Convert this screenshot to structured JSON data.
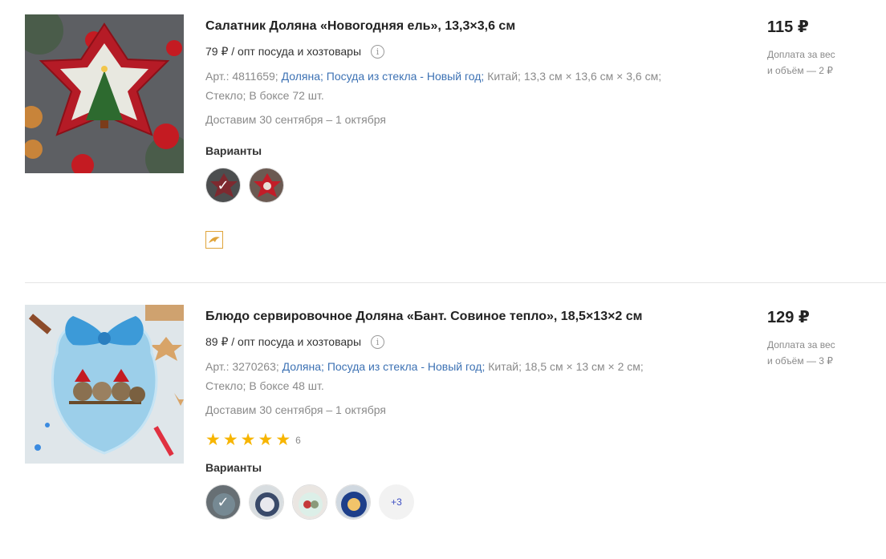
{
  "products": [
    {
      "title": "Салатник Доляна «Новогодняя ель», 13,3×3,6 см",
      "unit_price": "79 ₽ / опт посуда и хозтовары",
      "info_icon": "i",
      "art": "Арт.: 4811659;",
      "brand": "Доляна;",
      "category": "Посуда из стекла - Новый год;",
      "country": "Китай;",
      "dimensions": "13,3 см × 13,6 см × 3,6 см;",
      "material": "Стекло;",
      "box": "В боксе 72 шт.",
      "delivery": "Доставим 30 сентября – 1 октября",
      "variants_label": "Варианты",
      "variants": [
        "selected",
        "star-bowl"
      ],
      "price": "115 ₽",
      "surcharge_line1": "Доплата за вес",
      "surcharge_line2": "и объём — 2 ₽"
    },
    {
      "title": "Блюдо сервировочное Доляна «Бант. Совиное тепло», 18,5×13×2 см",
      "unit_price": "89 ₽ / опт посуда и хозтовары",
      "info_icon": "i",
      "art": "Арт.: 3270263;",
      "brand": "Доляна;",
      "category": "Посуда из стекла - Новый год;",
      "country": "Китай;",
      "dimensions": "18,5 см × 13 см × 2 см;",
      "material": "Стекло;",
      "box": "В боксе 48 шт.",
      "delivery": "Доставим 30 сентября – 1 октября",
      "rating": 5,
      "rating_count": "6",
      "variants_label": "Варианты",
      "variants_more": "+3",
      "price": "129 ₽",
      "surcharge_line1": "Доплата за вес",
      "surcharge_line2": "и объём — 3 ₽"
    }
  ],
  "colors": {
    "link": "#3d72b4",
    "star": "#f7b500",
    "badge": "#e0a43a"
  }
}
